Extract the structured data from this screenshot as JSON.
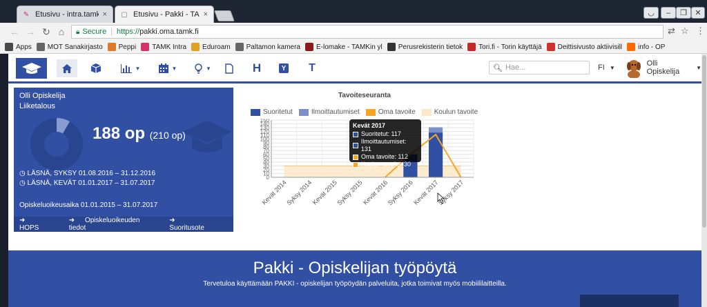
{
  "browser": {
    "tabs": [
      {
        "title": "Etusivu - intra.tamk.fi",
        "close": "×"
      },
      {
        "title": "Etusivu - Pakki - TAMK",
        "close": "×"
      }
    ],
    "secure_label": "Secure",
    "url_scheme": "https://",
    "url_host": "pakki.oma.tamk.fi",
    "bookmarks": [
      {
        "label": "Apps",
        "icon": "apps-grid-icon",
        "color": "#4a4a4a"
      },
      {
        "label": "MOT Sanakirjasto",
        "icon": "page-icon",
        "color": "#666666"
      },
      {
        "label": "Peppi",
        "icon": "peppi-icon",
        "color": "#e07a2b"
      },
      {
        "label": "TAMK Intra",
        "icon": "tamk-icon",
        "color": "#d6336c"
      },
      {
        "label": "Eduroam",
        "icon": "eduroam-icon",
        "color": "#e0a020"
      },
      {
        "label": "Paltamon kamera",
        "icon": "page-icon",
        "color": "#666666"
      },
      {
        "label": "E-lomake - TAMKin yl",
        "icon": "elomake-icon",
        "color": "#8b1a1a"
      },
      {
        "label": "Perusrekisterin tietok",
        "icon": "book-icon",
        "color": "#333333"
      },
      {
        "label": "Tori.fi - Torin käyttäjä",
        "icon": "tori-icon",
        "color": "#c62828"
      },
      {
        "label": "Deittisivusto aktiivisill",
        "icon": "heart-icon",
        "color": "#d32f2f"
      },
      {
        "label": "info - OP",
        "icon": "op-icon",
        "color": "#ff6a00"
      }
    ]
  },
  "app": {
    "search_placeholder": "Hae...",
    "lang": "FI",
    "user_name": "Olli Opiskelija",
    "accent": "#3150a3"
  },
  "card": {
    "name": "Olli Opiskelija",
    "dept": "Liiketalous",
    "op_big": "188 op",
    "op_total": "(210 op)",
    "status1": "LÄSNÄ, SYKSY 01.08.2016 – 31.12.2016",
    "status2": "LÄSNÄ, KEVÄT 01.01.2017 – 31.07.2017",
    "period": "Opiskeluoikeusaika 01.01.2015 – 31.07.2017",
    "links": [
      "HOPS",
      "Opiskeluoikeuden tiedot",
      "Suoritusote"
    ]
  },
  "chart_data": {
    "type": "bar",
    "title": "Tavoiteseuranta",
    "categories": [
      "Kevät 2014",
      "Syksy 2014",
      "Kevät 2015",
      "Syksy 2015",
      "Kevät 2016",
      "Syksy 2016",
      "Kevät 2017",
      "Syksy 2017"
    ],
    "yticks": [
      0,
      10,
      20,
      30,
      40,
      50,
      60,
      70,
      80,
      90,
      100,
      110,
      120,
      130,
      140,
      150
    ],
    "ylim": [
      0,
      150
    ],
    "series": [
      {
        "name": "Suoritetut",
        "kind": "bar",
        "color": "#3150a3",
        "values": [
          0,
          0,
          0,
          0,
          0,
          60,
          117,
          0
        ]
      },
      {
        "name": "Ilmoittautumiset",
        "kind": "bar",
        "color": "#7c8fc8",
        "values": [
          0,
          0,
          0,
          0,
          0,
          60,
          131,
          0
        ]
      },
      {
        "name": "Oma tavoite",
        "kind": "line",
        "color": "#f5a623",
        "values": [
          null,
          null,
          null,
          null,
          0,
          60,
          112,
          0
        ]
      },
      {
        "name": "Koulun tavoite",
        "kind": "area",
        "color": "#fde9c8",
        "values": [
          30,
          30,
          30,
          30,
          30,
          30,
          30,
          30
        ]
      }
    ],
    "tooltip": {
      "title": "Kevät 2017",
      "rows": [
        {
          "label": "Suoritetut: 117",
          "color": "#3150a3"
        },
        {
          "label": "Ilmoittautumiset: 131",
          "color": "#3150a3"
        },
        {
          "label": "Oma tavoite: 112",
          "color": "#f5a623"
        },
        {
          "label": "Koulun tavoite: 30",
          "color": "#f5a623"
        }
      ]
    }
  },
  "banner": {
    "title": "Pakki - Opiskelijan työpöytä",
    "subtitle": "Tervetuloa käyttämään PAKKI - opiskelijan työpöydän palveluita, jotka toimivat myös mobiililaitteilla."
  }
}
